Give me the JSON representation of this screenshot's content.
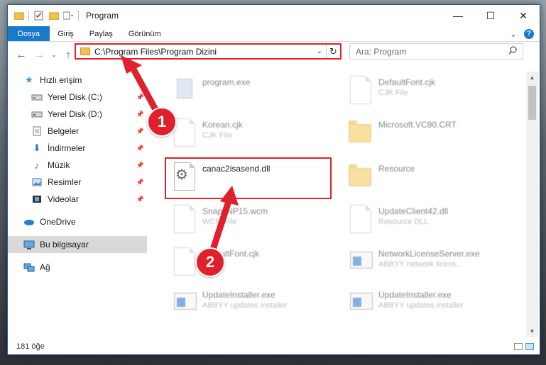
{
  "window": {
    "title": "Program"
  },
  "titlebar": {
    "minimize": "—",
    "maximize": "☐",
    "close": "✕"
  },
  "ribbon": {
    "tabs": [
      "Dosya",
      "Giriş",
      "Paylaş",
      "Görünüm"
    ],
    "collapse": "⌄",
    "help": "?"
  },
  "nav": {
    "back": "←",
    "forward": "→",
    "recent": "⌄",
    "up": "↑"
  },
  "address": {
    "path": "C:\\Program Files\\Program Dizini",
    "dropdown": "⌄",
    "refresh": "↻"
  },
  "search": {
    "placeholder": "Ara: Program",
    "icon": "🔍"
  },
  "sidebar": {
    "quick_access": "Hızlı erişim",
    "items": [
      {
        "label": "Yerel Disk (C:)",
        "icon": "drive-icon"
      },
      {
        "label": "Yerel Disk (D:)",
        "icon": "drive-icon"
      },
      {
        "label": "Belgeler",
        "icon": "documents-icon"
      },
      {
        "label": "İndirmeler",
        "icon": "download-icon"
      },
      {
        "label": "Müzik",
        "icon": "music-icon"
      },
      {
        "label": "Resimler",
        "icon": "pictures-icon"
      },
      {
        "label": "Videolar",
        "icon": "videos-icon"
      }
    ],
    "onedrive": "OneDrive",
    "this_pc": "Bu bilgisayar",
    "network": "Ağ"
  },
  "files": {
    "col1": [
      {
        "name": "program.exe",
        "sub": ""
      },
      {
        "name": "Korean.cjk",
        "sub": "CJK File"
      },
      {
        "name": "canac2isasend.dll",
        "sub": ""
      },
      {
        "name": "SnapsNP15.wcm",
        "sub": "WCM File"
      },
      {
        "name": "DefaultFont.cjk",
        "sub": ""
      },
      {
        "name": "UpdateInstaller.exe",
        "sub": "ABBYY updates installer"
      }
    ],
    "col2": [
      {
        "name": "DefaultFont.cjk",
        "sub": "CJK File"
      },
      {
        "name": "Microsoft.VC90.CRT",
        "sub": ""
      },
      {
        "name": "Resource",
        "sub": ""
      },
      {
        "name": "UpdateClient42.dll",
        "sub": "Resource DLL"
      },
      {
        "name": "NetworkLicenseServer.exe",
        "sub": "ABBYY network licens..."
      },
      {
        "name": "UpdateInstaller.exe",
        "sub": "ABBYY updates installer"
      }
    ]
  },
  "status": {
    "count": "181 öğe"
  },
  "annotations": {
    "step1": "1",
    "step2": "2",
    "color": "#e0202a"
  }
}
